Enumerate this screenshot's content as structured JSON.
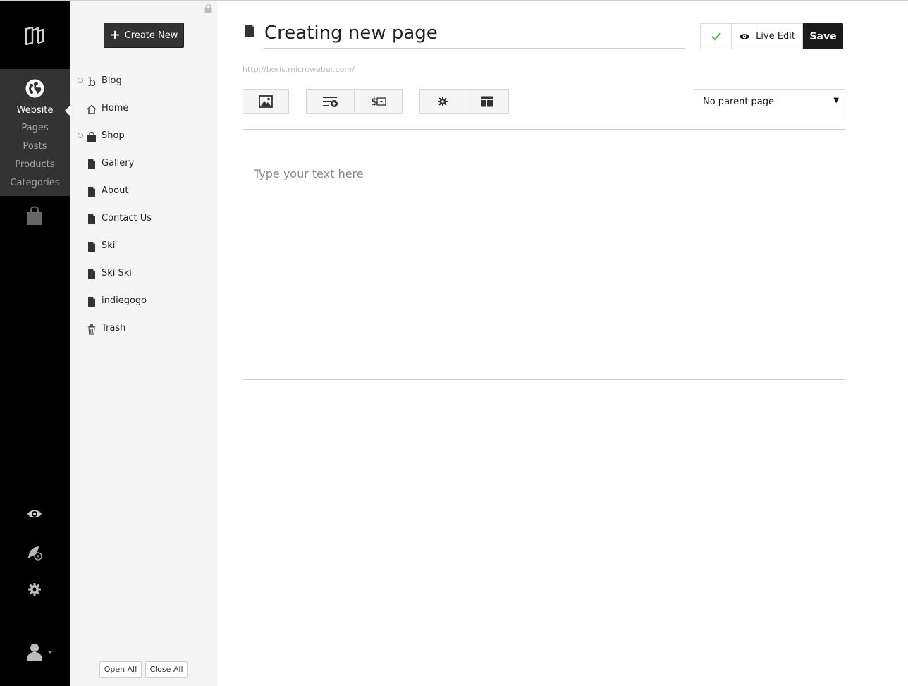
{
  "sidebar": {
    "website_label": "Website",
    "links": [
      "Pages",
      "Posts",
      "Products",
      "Categories"
    ],
    "icons": [
      "microweber-logo-icon",
      "globe-icon",
      "shop-bag-icon",
      "eye-icon",
      "rocket-icon",
      "gear-icon",
      "user-icon"
    ]
  },
  "tree": {
    "create_new_label": "Create New",
    "items": [
      {
        "label": "Blog",
        "icon": "blog-icon",
        "expandable": true
      },
      {
        "label": "Home",
        "icon": "home-icon",
        "expandable": false
      },
      {
        "label": "Shop",
        "icon": "shop-bag-icon",
        "expandable": true
      },
      {
        "label": "Gallery",
        "icon": "page-icon",
        "expandable": false
      },
      {
        "label": "About",
        "icon": "page-icon",
        "expandable": false
      },
      {
        "label": "Contact Us",
        "icon": "page-icon",
        "expandable": false
      },
      {
        "label": "Ski",
        "icon": "page-icon",
        "expandable": false
      },
      {
        "label": "Ski Ski",
        "icon": "page-icon",
        "expandable": false
      },
      {
        "label": "indiegogo",
        "icon": "page-icon",
        "expandable": false
      },
      {
        "label": "Trash",
        "icon": "trash-icon",
        "expandable": false
      }
    ],
    "open_all_label": "Open All",
    "close_all_label": "Close All"
  },
  "editor": {
    "title_value": "Creating new page",
    "live_edit_label": "Live Edit",
    "save_label": "Save",
    "url": "http://boris.microweber.com/",
    "parent_page_selected": "No parent page",
    "placeholder": "Type your text here",
    "toolbar_icons": [
      "image-icon",
      "add-list-icon",
      "price-icon",
      "gear-icon",
      "layout-icon"
    ]
  },
  "colors": {
    "sidebar_bg": "#000000",
    "sidebar_active_bg": "#333333",
    "tree_bg": "#f5f5f5",
    "save_bg": "#1a1a1a",
    "check_green": "#4caf50"
  }
}
